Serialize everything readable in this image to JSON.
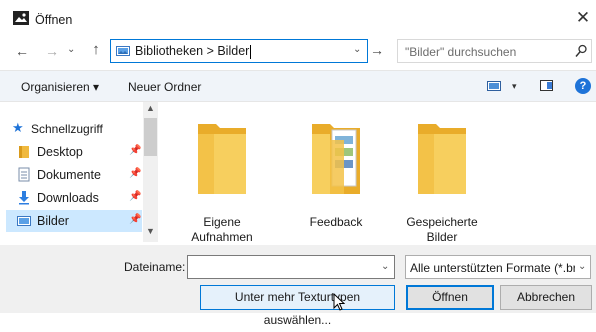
{
  "window": {
    "title": "Öffnen",
    "close_label": "✕"
  },
  "nav": {
    "back": "←",
    "forward": "→",
    "recent": "⌄",
    "up": "↑",
    "address_path": "Bibliotheken > Bilder",
    "address_dropdown": "⌄",
    "go": "→",
    "search_placeholder": "\"Bilder\" durchsuchen"
  },
  "toolbar": {
    "organize": "Organisieren ▾",
    "new_folder": "Neuer Ordner",
    "view_dropdown": "▾",
    "help": "?"
  },
  "sidebar": {
    "items": [
      {
        "label": "Schnellzugriff",
        "icon": "star-icon"
      },
      {
        "label": "Desktop",
        "icon": "desktop-folder-icon",
        "pinned": true
      },
      {
        "label": "Dokumente",
        "icon": "documents-icon",
        "pinned": true
      },
      {
        "label": "Downloads",
        "icon": "downloads-icon",
        "pinned": true
      },
      {
        "label": "Bilder",
        "icon": "pictures-icon",
        "pinned": true,
        "selected": true
      }
    ],
    "pin_glyph": "📌"
  },
  "files": [
    {
      "name": "Eigene Aufnahmen",
      "icon": "folder-icon"
    },
    {
      "name": "Feedback",
      "icon": "folder-with-images-icon"
    },
    {
      "name": "Gespeicherte Bilder",
      "icon": "folder-icon"
    }
  ],
  "bottom": {
    "filename_label": "Dateiname:",
    "filename_value": "",
    "filetype_selected": "Alle unterstützten Formate (*.br",
    "more_types_button": "Unter mehr Texturtypen auswählen...",
    "open_button": "Öffnen",
    "cancel_button": "Abbrechen"
  },
  "colors": {
    "accent": "#0078d7",
    "selection": "#cce8ff",
    "folder": "#f5c94c",
    "help": "#1e73d8"
  }
}
